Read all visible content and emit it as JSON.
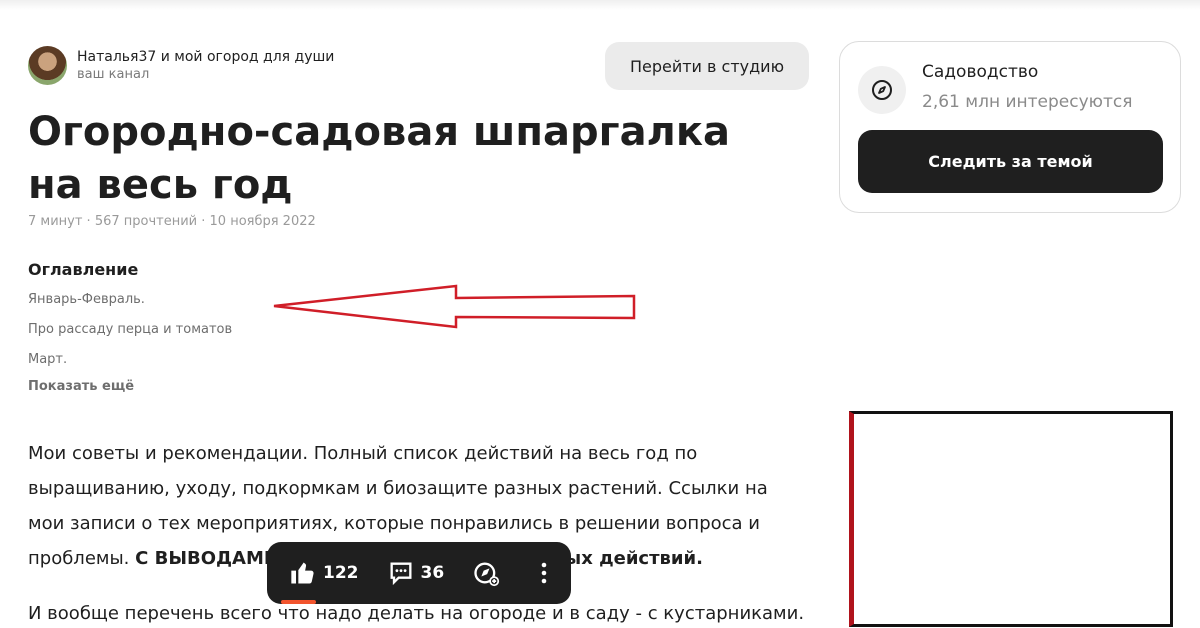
{
  "channel": {
    "name": "Наталья37 и мой огород для души",
    "subtitle": "ваш канал"
  },
  "studio_button": "Перейти в студию",
  "article": {
    "title": "Огородно-садовая шпаргалка на весь год",
    "meta": "7 минут · 567 прочтений · 10 ноября 2022",
    "toc": {
      "heading": "Оглавление",
      "items": [
        "Январь-Февраль.",
        "Про рассаду перца и томатов",
        "Март."
      ],
      "show_more": "Показать ещё"
    },
    "paragraph1_text": "Мои советы и рекомендации. Полный список действий на весь год по выращиванию, уходу, подкормкам и биозащите разных растений. Ссылки на мои записи о тех мероприятиях, которые понравились в решении вопроса и проблемы. ",
    "paragraph1_bold": "С ВЫВОДАМИ и результатами тех или иных действий.",
    "paragraph2": "И вообще перечень всего что надо делать на огороде и в саду - с кустарниками."
  },
  "actions": {
    "likes": "122",
    "comments": "36"
  },
  "topic": {
    "name": "Садоводство",
    "followers": "2,61 млн интересуются",
    "follow_button": "Следить за темой"
  },
  "colors": {
    "dark": "#1f1f1f",
    "arrow": "#d01e28",
    "accent": "#f2542d"
  },
  "icons": [
    "like-icon",
    "comment-icon",
    "share-icon",
    "more-icon",
    "compass-icon"
  ]
}
